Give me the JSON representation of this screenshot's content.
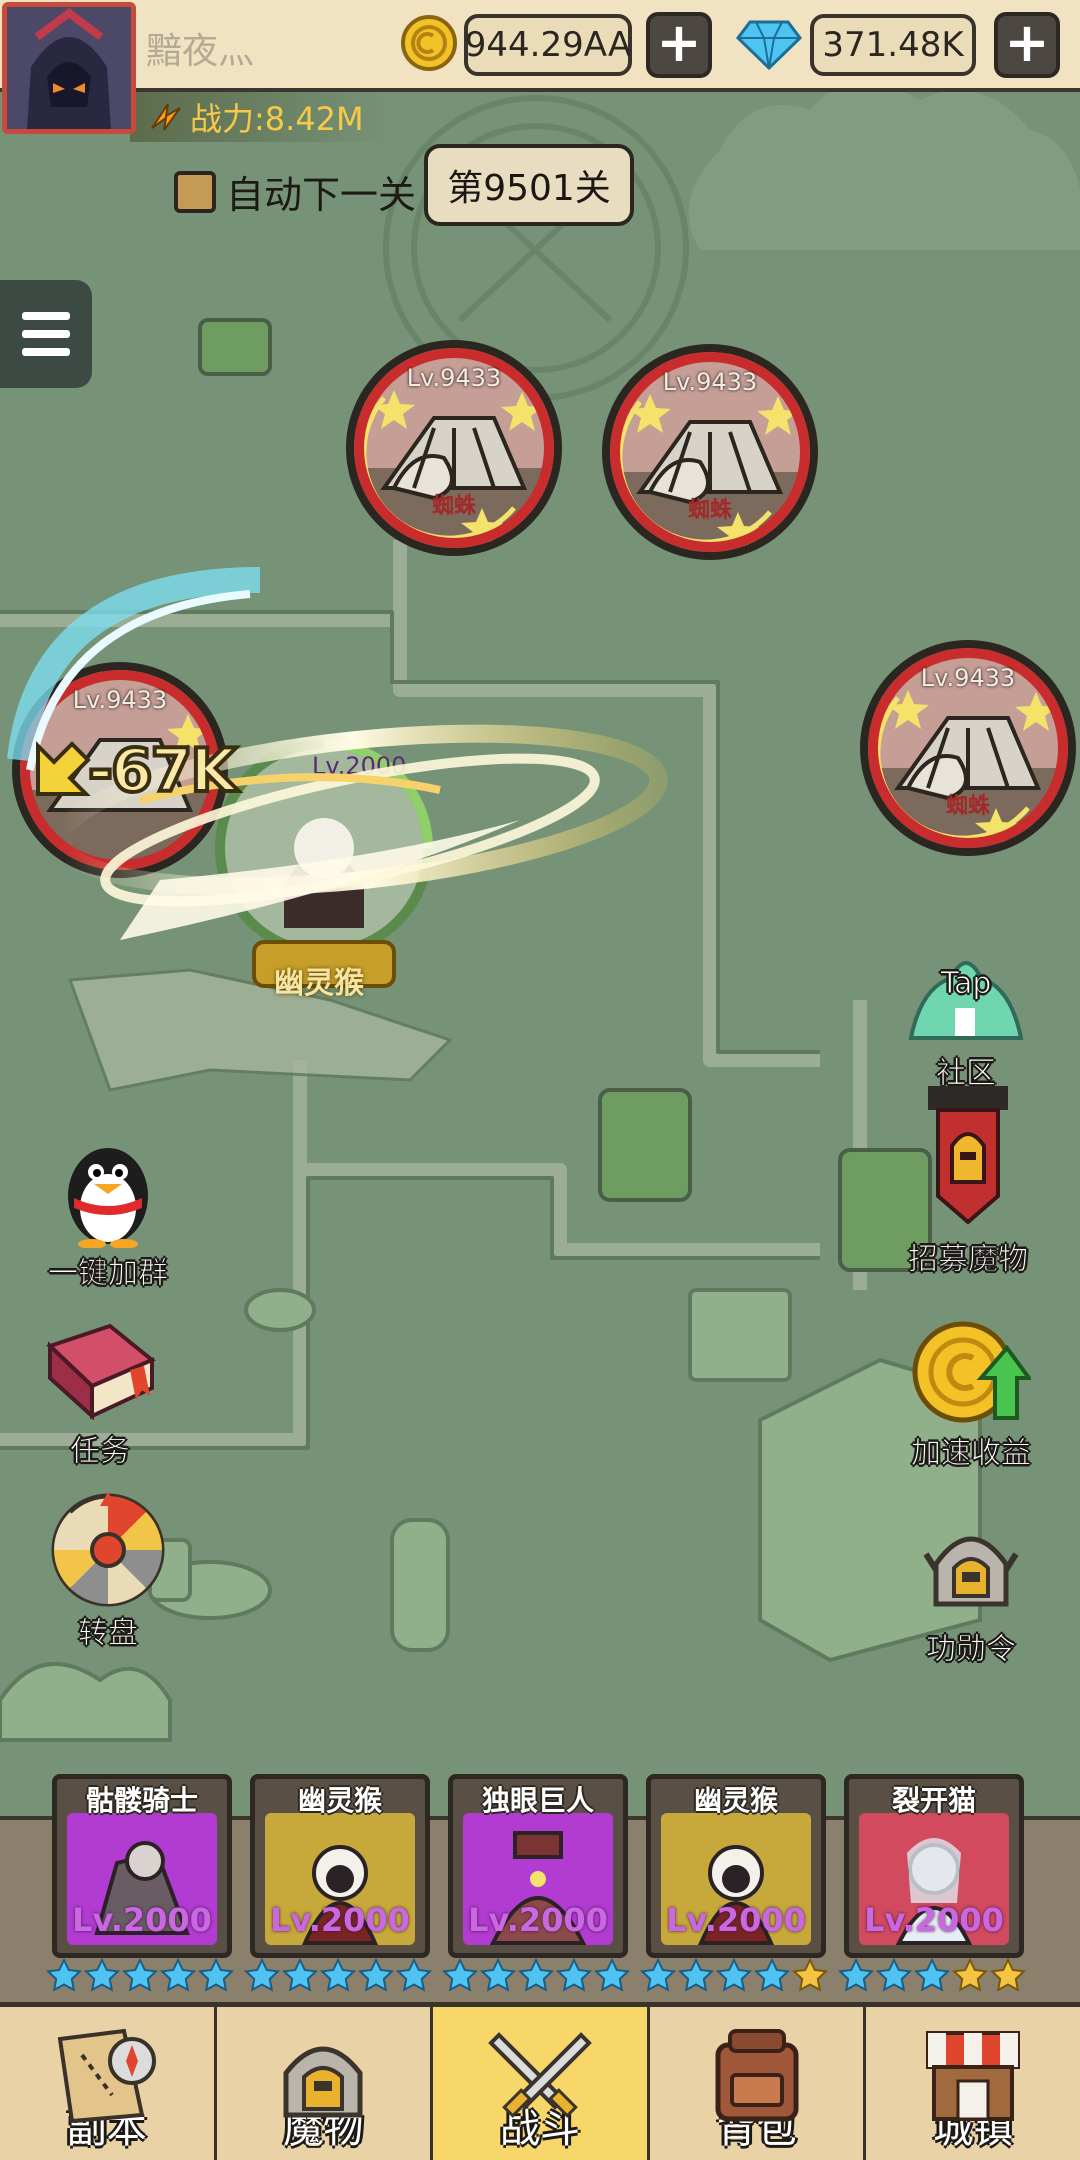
{
  "player": {
    "name": "黯夜灬",
    "power": "战力:8.42M"
  },
  "currency": {
    "gold": "944.29AA",
    "gems": "371.48K"
  },
  "controls": {
    "auto_next": "自动下一关",
    "stage": "第9501关",
    "plus": "+"
  },
  "enemies": [
    {
      "level": "Lv.9433",
      "name": "蜘蛛"
    },
    {
      "level": "Lv.9433",
      "name": "蜘蛛"
    },
    {
      "level": "Lv.9433",
      "name": ""
    },
    {
      "level": "Lv.9433",
      "name": "蜘蛛"
    }
  ],
  "hero": {
    "level": "Lv.2000",
    "name": "幽灵猴",
    "damage": "-67K"
  },
  "side_left": {
    "group": "一键加群",
    "task": "任务",
    "wheel": "转盘"
  },
  "side_right": {
    "tap": "Tap",
    "community": "社区",
    "recruit": "招募魔物",
    "speedup": "加速收益",
    "merit": "功勋令"
  },
  "team": [
    {
      "name": "骷髅骑士",
      "level": "Lv.2000",
      "bg": "#b23bd1",
      "stars": [
        "blue",
        "blue",
        "blue",
        "blue",
        "blue"
      ]
    },
    {
      "name": "幽灵猴",
      "level": "Lv.2000",
      "bg": "#c6a93a",
      "stars": [
        "blue",
        "blue",
        "blue",
        "blue",
        "blue"
      ]
    },
    {
      "name": "独眼巨人",
      "level": "Lv.2000",
      "bg": "#b23bd1",
      "stars": [
        "blue",
        "blue",
        "blue",
        "blue",
        "blue"
      ]
    },
    {
      "name": "幽灵猴",
      "level": "Lv.2000",
      "bg": "#c6a93a",
      "stars": [
        "blue",
        "blue",
        "blue",
        "blue",
        "gold"
      ]
    },
    {
      "name": "裂开猫",
      "level": "Lv.2000",
      "bg": "#d24a5e",
      "stars": [
        "blue",
        "blue",
        "blue",
        "gold",
        "gold"
      ]
    }
  ],
  "nav": {
    "dungeon": "副本",
    "monster": "魔物",
    "battle": "战斗",
    "bag": "背包",
    "town": "城镇"
  },
  "colors": {
    "map_bg": "#769377",
    "ring_red": "#c92c2c",
    "power_gold": "#f7c948",
    "nav_active": "#f7d66a"
  }
}
